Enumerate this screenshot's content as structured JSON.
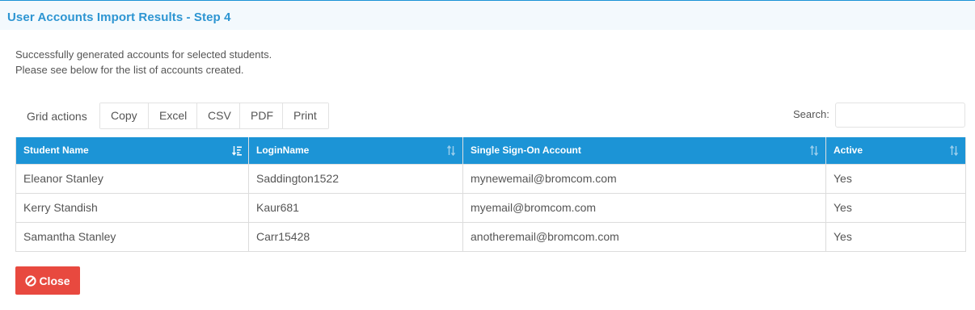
{
  "header": {
    "title": "User Accounts Import Results - Step 4"
  },
  "message": {
    "line1": "Successfully generated accounts for selected students.",
    "line2": "Please see below for the list of accounts created."
  },
  "toolbar": {
    "label": "Grid actions",
    "buttons": [
      "Copy",
      "Excel",
      "CSV",
      "PDF",
      "Print"
    ]
  },
  "search": {
    "label": "Search:",
    "value": "",
    "placeholder": ""
  },
  "table": {
    "columns": [
      "Student Name",
      "LoginName",
      "Single Sign-On Account",
      "Active"
    ],
    "rows": [
      [
        "Eleanor Stanley",
        "Saddington1522",
        "mynewemail@bromcom.com",
        "Yes"
      ],
      [
        "Kerry Standish",
        "Kaur681",
        "myemail@bromcom.com",
        "Yes"
      ],
      [
        "Samantha Stanley",
        "Carr15428",
        "anotheremail@bromcom.com",
        "Yes"
      ]
    ]
  },
  "close_button": {
    "label": "Close",
    "icon": "ban-icon"
  },
  "colors": {
    "accent": "#1c94d6",
    "title": "#2d95d2",
    "header_bg": "#f3f9fd",
    "danger": "#e8493f"
  }
}
